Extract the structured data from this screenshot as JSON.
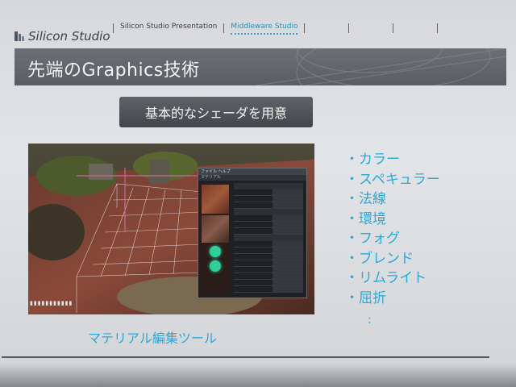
{
  "brand": {
    "name": "Silicon Studio"
  },
  "nav": {
    "items": [
      "Silicon Studio Presentation",
      "Middleware Studio"
    ],
    "active_index": 1
  },
  "slide": {
    "title": "先端のGraphics技術",
    "subtitle": "基本的なシェーダを用意",
    "features": [
      "・カラー",
      "・スペキュラー",
      "・法線",
      "・環境",
      "・フォグ",
      "・ブレンド",
      "・リムライト",
      "・屈折"
    ],
    "features_more": ":",
    "caption": "マテリアル編集ツール"
  },
  "screenshot": {
    "panel_title": "ファイル ヘルプ",
    "panel_tabs": [
      "マテリアル"
    ]
  },
  "colors": {
    "accent": "#2aa9d8",
    "title_band": "#5f6268",
    "subtitle_box": "#4c4f55",
    "slide_background": "#dcdee1"
  },
  "icons": [
    "silicon-studio-logo-icon"
  ]
}
